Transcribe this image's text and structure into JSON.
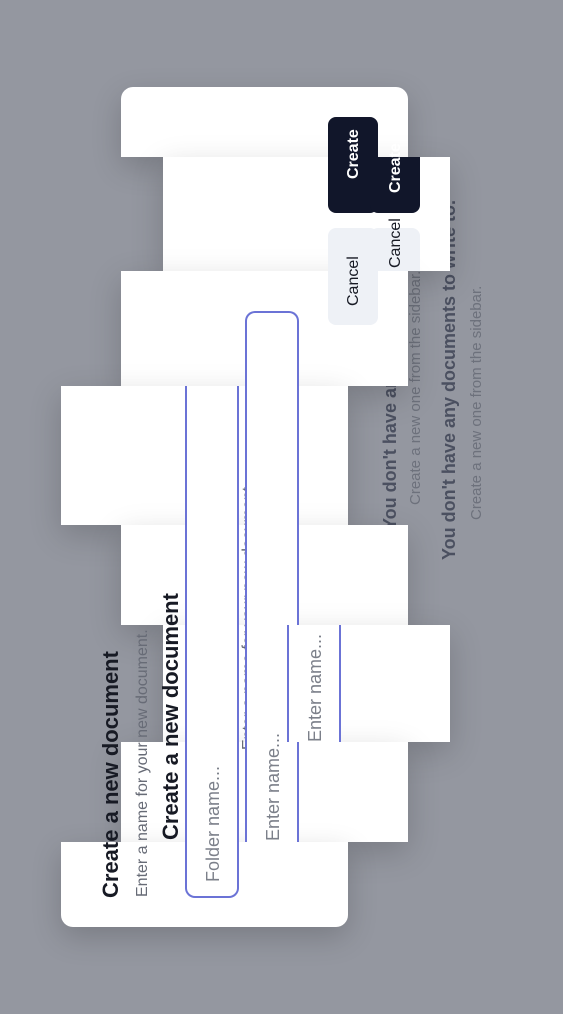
{
  "empty_state": {
    "title": "You don't have any documents to write to.",
    "subtitle": "Create a new one from the sidebar."
  },
  "dialog": {
    "title": "Create a new document",
    "description": "Enter a name for your new document.",
    "folder_placeholder": "Folder name...",
    "name_placeholder": "Enter name...",
    "cancel_label": "Cancel",
    "create_label": "Create"
  },
  "colors": {
    "backdrop": "#9497a0",
    "accent_border": "#6b73d6",
    "primary_button": "#11162a",
    "secondary_button": "#eef1f6"
  }
}
